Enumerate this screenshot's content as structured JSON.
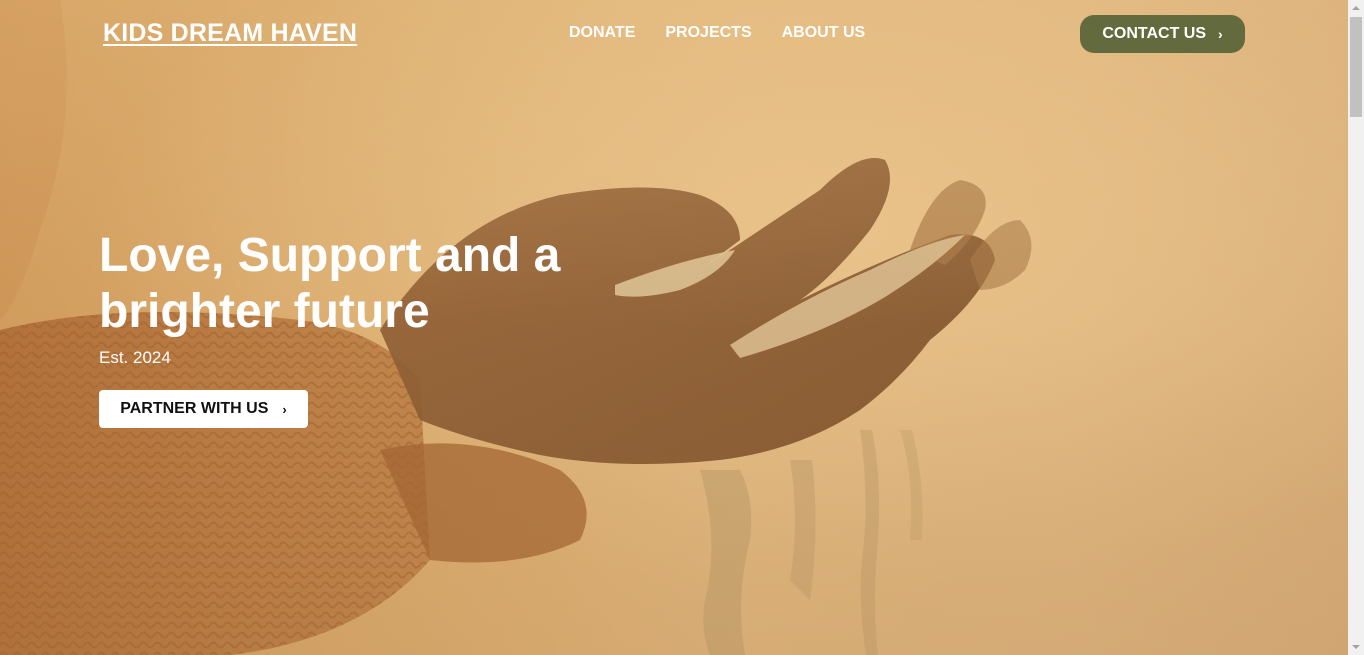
{
  "header": {
    "logo": "KIDS DREAM HAVEN",
    "nav": [
      {
        "label": "DONATE"
      },
      {
        "label": "PROJECTS"
      },
      {
        "label": "ABOUT US"
      }
    ],
    "contact_label": "CONTACT US",
    "contact_icon": "chevron-right-icon"
  },
  "hero": {
    "headline": "Love, Support and a brighter future",
    "established": "Est. 2024",
    "cta_label": "PARTNER WITH US",
    "cta_icon": "chevron-right-icon",
    "image": "hands-holding-sand-photo"
  },
  "colors": {
    "contact_button": "#636b3e",
    "hero_tint": "#dbb27a",
    "text": "#ffffff"
  }
}
